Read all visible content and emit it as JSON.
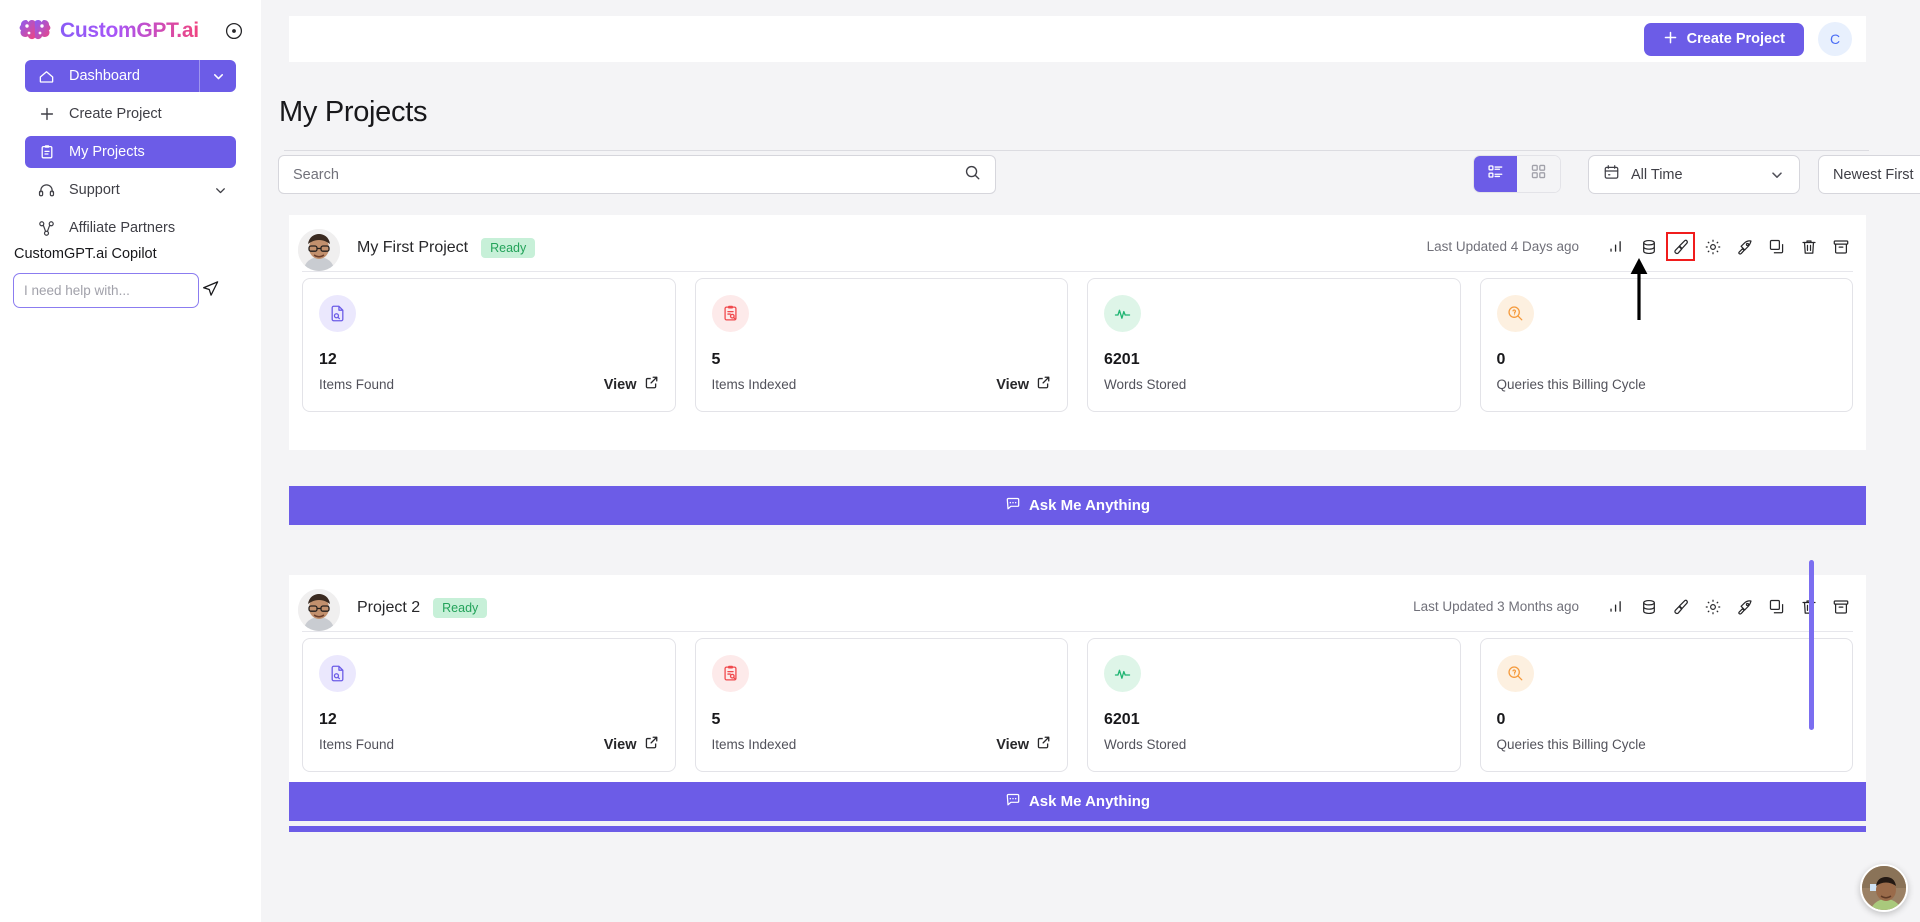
{
  "sidebar": {
    "brand": "CustomGPT.ai",
    "info_icon": "info-circle-icon",
    "dashboard": {
      "label": "Dashboard",
      "icon": "home-icon",
      "caret": "chevron-down-icon"
    },
    "items": [
      {
        "label": "Create Project",
        "icon": "plus-icon",
        "active": false,
        "caret": null
      },
      {
        "label": "My Projects",
        "icon": "clipboard-icon",
        "active": true,
        "caret": null
      },
      {
        "label": "Support",
        "icon": "headset-icon",
        "active": false,
        "caret": "chevron-down-icon"
      },
      {
        "label": "Affiliate Partners",
        "icon": "share-nodes-icon",
        "active": false,
        "caret": null
      }
    ],
    "copilot": {
      "title": "CustomGPT.ai Copilot",
      "input_value": "",
      "placeholder": "I need help with...",
      "send_icon": "send-plane-icon"
    }
  },
  "topbar": {
    "create_project_label": "Create Project",
    "create_project_icon": "plus-icon",
    "avatar_initial": "C"
  },
  "page": {
    "title": "My Projects"
  },
  "toolbar": {
    "search": {
      "value": "",
      "placeholder": "Search",
      "icon": "search-icon"
    },
    "view_toggle": {
      "list_icon": "list-view-icon",
      "grid_icon": "grid-view-icon",
      "active": "list"
    },
    "date_filter": {
      "value": "All Time",
      "icon": "calendar-icon",
      "caret": "chevron-down-icon"
    },
    "sort_filter": {
      "value": "Newest First",
      "caret": "chevron-down-icon"
    }
  },
  "action_icons": [
    {
      "name": "analytics-bar-chart-icon",
      "highlighted": false
    },
    {
      "name": "database-icon",
      "highlighted": false
    },
    {
      "name": "paintbrush-icon",
      "highlighted": true
    },
    {
      "name": "settings-gear-icon",
      "highlighted": false
    },
    {
      "name": "rocket-deploy-icon",
      "highlighted": false
    },
    {
      "name": "duplicate-copy-icon",
      "highlighted": false
    },
    {
      "name": "delete-trash-icon",
      "highlighted": false
    },
    {
      "name": "archive-box-icon",
      "highlighted": false
    }
  ],
  "projects": [
    {
      "name": "My First Project",
      "status": "Ready",
      "updated": "Last Updated 4 Days ago",
      "avatar": "user-photo-avatar",
      "ask_label": "Ask Me Anything",
      "ask_icon": "chat-bubble-icon",
      "stats": [
        {
          "value": "12",
          "label": "Items Found",
          "icon": "file-search-icon",
          "icon_color": "#6c5ce7",
          "icon_bg": "#ebe8fd",
          "view_label": "View",
          "view_icon": "external-link-icon",
          "has_view": true
        },
        {
          "value": "5",
          "label": "Items Indexed",
          "icon": "clipboard-search-icon",
          "icon_color": "#f0484c",
          "icon_bg": "#fdeaea",
          "view_label": "View",
          "view_icon": "external-link-icon",
          "has_view": true
        },
        {
          "value": "6201",
          "label": "Words Stored",
          "icon": "activity-pulse-icon",
          "icon_color": "#22b573",
          "icon_bg": "#def5e8",
          "view_label": "",
          "view_icon": "",
          "has_view": false
        },
        {
          "value": "0",
          "label": "Queries this Billing Cycle",
          "icon": "query-search-icon",
          "icon_color": "#f59a3c",
          "icon_bg": "#fdf0e0",
          "view_label": "",
          "view_icon": "",
          "has_view": false
        }
      ]
    },
    {
      "name": "Project 2",
      "status": "Ready",
      "updated": "Last Updated 3 Months ago",
      "avatar": "user-photo-avatar",
      "ask_label": "Ask Me Anything",
      "ask_icon": "chat-bubble-icon",
      "stats": [
        {
          "value": "12",
          "label": "Items Found",
          "icon": "file-search-icon",
          "icon_color": "#6c5ce7",
          "icon_bg": "#ebe8fd",
          "view_label": "View",
          "view_icon": "external-link-icon",
          "has_view": true
        },
        {
          "value": "5",
          "label": "Items Indexed",
          "icon": "clipboard-search-icon",
          "icon_color": "#f0484c",
          "icon_bg": "#fdeaea",
          "view_label": "View",
          "view_icon": "external-link-icon",
          "has_view": true
        },
        {
          "value": "6201",
          "label": "Words Stored",
          "icon": "activity-pulse-icon",
          "icon_color": "#22b573",
          "icon_bg": "#def5e8",
          "view_label": "",
          "view_icon": "",
          "has_view": false
        },
        {
          "value": "0",
          "label": "Queries this Billing Cycle",
          "icon": "query-search-icon",
          "icon_color": "#f59a3c",
          "icon_bg": "#fdf0e0",
          "view_label": "",
          "view_icon": "",
          "has_view": false
        }
      ]
    }
  ],
  "colors": {
    "accent_purple": "#6c5ce7",
    "ready_green": "#23a35a",
    "ready_green_bg": "#c7f0d8",
    "highlight_red": "#f01c1c",
    "page_bg": "#f4f4f6"
  },
  "chat_widget": {
    "icon": "support-agent-avatar"
  }
}
